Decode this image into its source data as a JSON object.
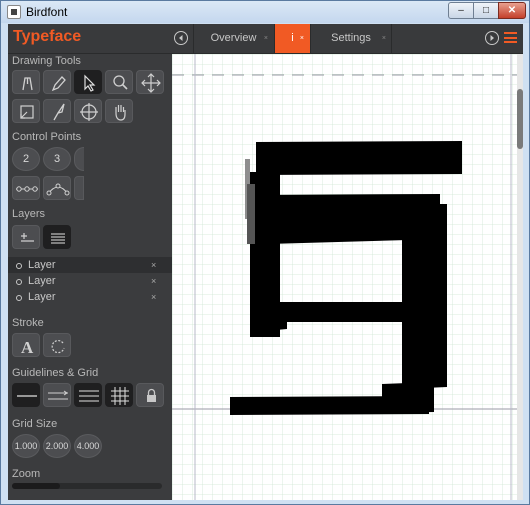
{
  "window": {
    "title": "Birdfont",
    "min": "–",
    "max": "□",
    "close": "✕"
  },
  "app": {
    "brand": "Typeface",
    "accent": "#f15a24"
  },
  "tabs": [
    {
      "label": "Overview",
      "close": "×",
      "active": false
    },
    {
      "label": "i",
      "close": "×",
      "active": true
    },
    {
      "label": "Settings",
      "close": "×",
      "active": false
    }
  ],
  "sidebar": {
    "drawing_tools": {
      "title": "Drawing Tools",
      "icons": [
        "pen-icon",
        "pencil-icon",
        "pointer-icon",
        "zoom-icon",
        "move-icon",
        "resize-icon",
        "knife-icon",
        "circle-target-icon",
        "hand-icon"
      ]
    },
    "control_points": {
      "title": "Control Points",
      "labels": [
        "2",
        "3"
      ]
    },
    "layers": {
      "title": "Layers",
      "items": [
        {
          "label": "Layer",
          "close": "×",
          "selected": true
        },
        {
          "label": "Layer",
          "close": "×",
          "selected": false
        },
        {
          "label": "Layer",
          "close": "×",
          "selected": false
        }
      ]
    },
    "stroke": {
      "title": "Stroke",
      "icons": [
        "stroke-a-icon",
        "rotate-icon"
      ]
    },
    "guidelines": {
      "title": "Guidelines & Grid"
    },
    "grid_size": {
      "title": "Grid Size",
      "values": [
        "1.000",
        "2.000",
        "4.000"
      ]
    },
    "zoom": {
      "title": "Zoom",
      "level": 0.32
    }
  }
}
